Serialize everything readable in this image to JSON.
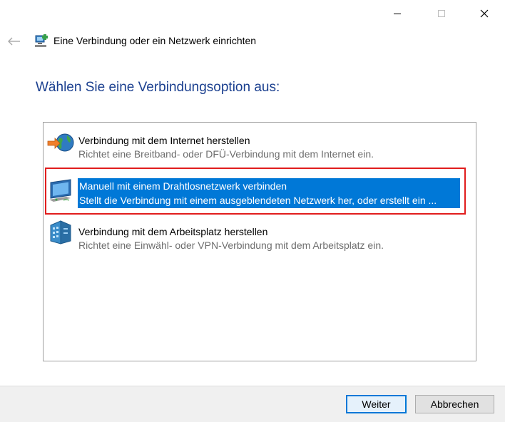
{
  "window": {
    "title": "Eine Verbindung oder ein Netzwerk einrichten",
    "icon": "network-setup-icon",
    "controls": [
      "minimize-icon",
      "maximize-icon",
      "close-icon"
    ],
    "back_icon": "back-arrow-icon"
  },
  "heading": "Wählen Sie eine Verbindungsoption aus:",
  "options": [
    {
      "title": "Verbindung mit dem Internet herstellen",
      "description": "Richtet eine Breitband- oder DFÜ-Verbindung mit dem Internet ein.",
      "icon": "globe-internet-icon",
      "selected": false
    },
    {
      "title": "Manuell mit einem Drahtlosnetzwerk verbinden",
      "description": "Stellt die Verbindung mit einem ausgeblendeten Netzwerk her, oder erstellt ein ...",
      "icon": "wireless-computer-icon",
      "selected": true
    },
    {
      "title": "Verbindung mit dem Arbeitsplatz herstellen",
      "description": "Richtet eine Einwähl- oder VPN-Verbindung mit dem Arbeitsplatz ein.",
      "icon": "workplace-building-icon",
      "selected": false
    }
  ],
  "buttons": {
    "next": "Weiter",
    "cancel": "Abbrechen"
  },
  "colors": {
    "heading": "#1a3f8f",
    "selection": "#0078d7",
    "highlight_border": "#e11d1d"
  }
}
